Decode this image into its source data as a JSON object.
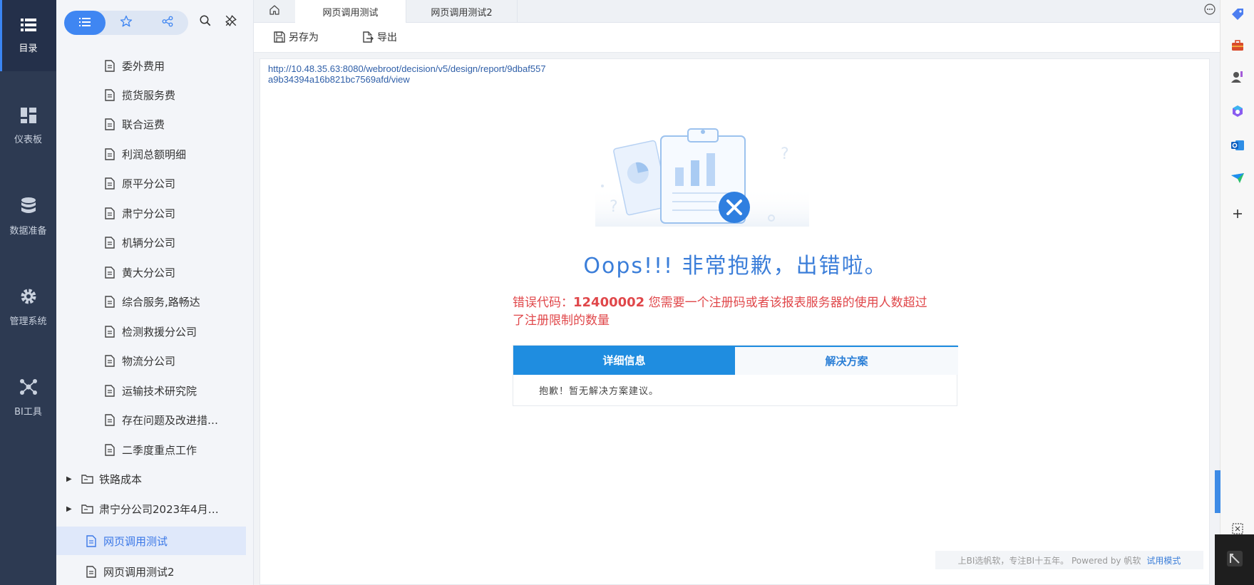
{
  "leftnav": {
    "items": [
      {
        "label": "目录",
        "icon": "list-icon"
      },
      {
        "label": "仪表板",
        "icon": "dashboard-icon"
      },
      {
        "label": "数据准备",
        "icon": "database-icon"
      },
      {
        "label": "管理系统",
        "icon": "gear-icon"
      },
      {
        "label": "BI工具",
        "icon": "network-icon"
      }
    ]
  },
  "tree": {
    "items": [
      {
        "label": "委外费用",
        "type": "file"
      },
      {
        "label": "揽货服务费",
        "type": "file"
      },
      {
        "label": "联合运费",
        "type": "file"
      },
      {
        "label": "利润总额明细",
        "type": "file"
      },
      {
        "label": "原平分公司",
        "type": "file"
      },
      {
        "label": "肃宁分公司",
        "type": "file"
      },
      {
        "label": "机辆分公司",
        "type": "file"
      },
      {
        "label": "黄大分公司",
        "type": "file"
      },
      {
        "label": "综合服务,路畅达",
        "type": "file"
      },
      {
        "label": "检测救援分公司",
        "type": "file"
      },
      {
        "label": "物流分公司",
        "type": "file"
      },
      {
        "label": "运输技术研究院",
        "type": "file"
      },
      {
        "label": "存在问题及改进措…",
        "type": "file"
      },
      {
        "label": "二季度重点工作",
        "type": "file"
      },
      {
        "label": "铁路成本",
        "type": "folder"
      },
      {
        "label": "肃宁分公司2023年4月…",
        "type": "folder"
      },
      {
        "label": "网页调用测试",
        "type": "file-root",
        "active": true
      },
      {
        "label": "网页调用测试2",
        "type": "file-root"
      }
    ]
  },
  "tabs": [
    {
      "label": "网页调用测试",
      "active": true
    },
    {
      "label": "网页调用测试2",
      "active": false
    }
  ],
  "toolbar": {
    "save_as": "另存为",
    "export": "导出"
  },
  "content": {
    "url_line1": "http://10.48.35.63:8080/webroot/decision/v5/design/report/9dbaf557",
    "url_line2": "a9b34394a16b821bc7569afd/view",
    "title": "Oops!!! 非常抱歉，出错啦。",
    "error_prefix": "错误代码：",
    "error_code": "12400002",
    "error_text_1": " 您需要一个注册码或者该报表服务器的使用人数超过",
    "error_text_2": "了注册限制的数量",
    "panel_tab_details": "详细信息",
    "panel_tab_solution": "解决方案",
    "panel_body": "抱歉！暂无解决方案建议。",
    "footer_text": "上BI选帆软，专注BI十五年。 Powered by 帆软",
    "footer_trial": "试用模式"
  },
  "colors": {
    "nav_bg": "#2d3a52",
    "accent": "#3b85f3",
    "error": "#e0474a",
    "title_blue": "#3b7ed9",
    "panel_blue": "#1f8de0"
  }
}
